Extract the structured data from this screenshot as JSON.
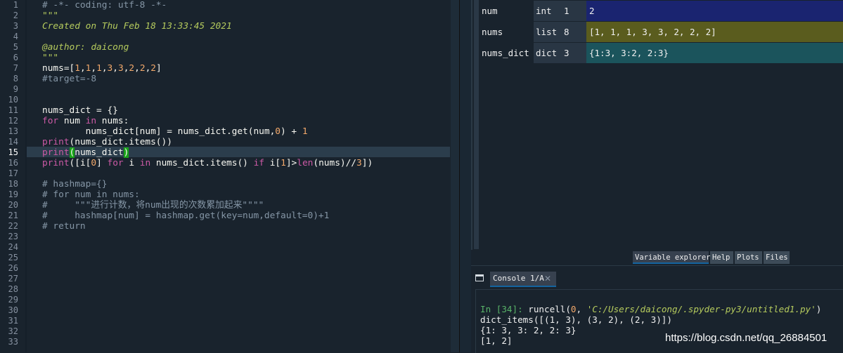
{
  "editor": {
    "line_numbers": [
      "1",
      "2",
      "3",
      "4",
      "5",
      "6",
      "7",
      "8",
      "9",
      "10",
      "11",
      "12",
      "13",
      "14",
      "15",
      "16",
      "17",
      "18",
      "19",
      "20",
      "21",
      "22",
      "23",
      "24",
      "25",
      "26",
      "27",
      "28",
      "29",
      "30",
      "31",
      "32",
      "33"
    ],
    "current_line": "15",
    "lines": {
      "l1": "# -*- coding: utf-8 -*-",
      "l2": "\"\"\"",
      "l3": "Created on Thu Feb 18 13:33:45 2021",
      "l5": "@author: daicong",
      "l6": "\"\"\"",
      "l7": {
        "a": "nums=[",
        "n": [
          "1",
          "1",
          "1",
          "3",
          "3",
          "2",
          "2",
          "2"
        ],
        "z": "]"
      },
      "l8": "#target=-8",
      "l11": "nums_dict = {}",
      "l12": {
        "kw1": "for",
        "a": " num ",
        "kw2": "in",
        "b": " nums:"
      },
      "l13": {
        "a": "        nums_dict[num] = nums_dict.get(num,",
        "n1": "0",
        "b": ") + ",
        "n2": "1"
      },
      "l14": {
        "bi": "print",
        "a": "(nums_dict.items())"
      },
      "l15": {
        "bi": "print",
        "open": "(",
        "a": "nums_dict",
        "close": ")"
      },
      "l16": {
        "bi": "print",
        "a": "([i[",
        "n1": "0",
        "b": "] ",
        "kw1": "for",
        "c": " i ",
        "kw2": "in",
        "d": " nums_dict.items() ",
        "kw3": "if",
        "e": " i[",
        "n2": "1",
        "f": "]>",
        "bi2": "len",
        "g": "(nums)//",
        "n3": "3",
        "h": "])"
      },
      "l18": "# hashmap={}",
      "l19": "# for num in nums:",
      "l20": "#     \"\"\"进行计数，将num出现的次数累加起来\"\"\"\"",
      "l21": "#     hashmap[num] = hashmap.get(key=num,default=0)+1",
      "l22": "# return"
    }
  },
  "variable_explorer": {
    "rows": [
      {
        "name": "num",
        "type": "int",
        "size": "1",
        "value": "2",
        "color": "#1a2470"
      },
      {
        "name": "nums",
        "type": "list",
        "size": "8",
        "value": "[1, 1, 1, 3, 3, 2, 2, 2]",
        "color": "#5a5c1e"
      },
      {
        "name": "nums_dict",
        "type": "dict",
        "size": "3",
        "value": "{1:3, 3:2, 2:3}",
        "color": "#1b545c"
      }
    ]
  },
  "pane_tabs": [
    "Variable explorer",
    "Help",
    "Plots",
    "Files"
  ],
  "console": {
    "tab_label": "Console 1/A",
    "tab_close": "✕",
    "prompt": "In [34]:",
    "cmd_a": " runcell(",
    "cmd_n": "0",
    "cmd_b": ", ",
    "cmd_path": "'C:/Users/daicong/.spyder-py3/untitled1.py'",
    "cmd_c": ")",
    "out1": "dict_items([(1, 3), (3, 2), (2, 3)])",
    "out2": "{1: 3, 3: 2, 2: 3}",
    "out3": "[1, 2]"
  },
  "watermark": "https://blog.csdn.net/qq_26884501"
}
